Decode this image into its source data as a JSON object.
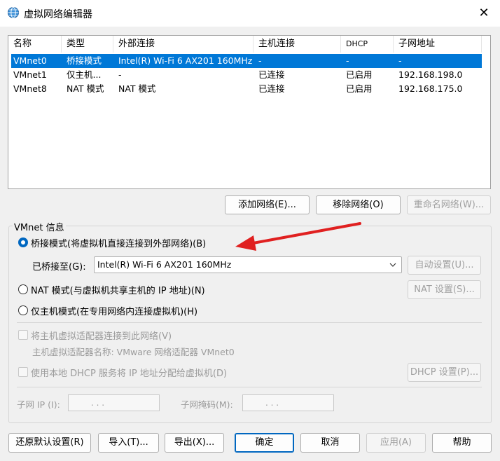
{
  "window": {
    "title": "虚拟网络编辑器",
    "close_glyph": "✕"
  },
  "list": {
    "columns": [
      "名称",
      "类型",
      "外部连接",
      "主机连接",
      "DHCP",
      "子网地址"
    ],
    "rows": [
      {
        "name": "VMnet0",
        "type": "桥接模式",
        "external": "Intel(R) Wi-Fi 6 AX201 160MHz",
        "host": "-",
        "dhcp": "-",
        "subnet": "-",
        "selected": true
      },
      {
        "name": "VMnet1",
        "type": "仅主机...",
        "external": "-",
        "host": "已连接",
        "dhcp": "已启用",
        "subnet": "192.168.198.0",
        "selected": false
      },
      {
        "name": "VMnet8",
        "type": "NAT 模式",
        "external": "NAT 模式",
        "host": "已连接",
        "dhcp": "已启用",
        "subnet": "192.168.175.0",
        "selected": false
      }
    ]
  },
  "list_buttons": {
    "add": "添加网络(E)...",
    "remove": "移除网络(O)",
    "rename": "重命名网络(W)..."
  },
  "vmnet_info": {
    "title": "VMnet 信息",
    "bridged_label": "桥接模式(将虚拟机直接连接到外部网络)(B)",
    "bridged_to_label": "已桥接至(G):",
    "bridged_to_value": "Intel(R) Wi-Fi 6 AX201 160MHz",
    "auto_settings": "自动设置(U)...",
    "nat_label": "NAT 模式(与虚拟机共享主机的 IP 地址)(N)",
    "nat_settings": "NAT 设置(S)...",
    "hostonly_label": "仅主机模式(在专用网络内连接虚拟机)(H)",
    "connect_adapter_label": "将主机虚拟适配器连接到此网络(V)",
    "adapter_name_label": "主机虚拟适配器名称: VMware 网络适配器 VMnet0",
    "dhcp_label": "使用本地 DHCP 服务将 IP 地址分配给虚拟机(D)",
    "dhcp_settings": "DHCP 设置(P)...",
    "subnet_ip_label": "子网 IP (I):",
    "subnet_mask_label": "子网掩码(M):",
    "ip_placeholder": ".    .    .",
    "selected_mode": "bridged"
  },
  "footer_buttons": {
    "restore": "还原默认设置(R)",
    "import": "导入(T)...",
    "export": "导出(X)...",
    "ok": "确定",
    "cancel": "取消",
    "apply": "应用(A)",
    "help": "帮助"
  },
  "colors": {
    "selection": "#0078d7",
    "accent": "#0067c0",
    "annotation_arrow": "#e02020"
  },
  "icons": {
    "app": "network-globe-icon",
    "close": "close-icon",
    "dropdown": "chevron-down-icon"
  }
}
